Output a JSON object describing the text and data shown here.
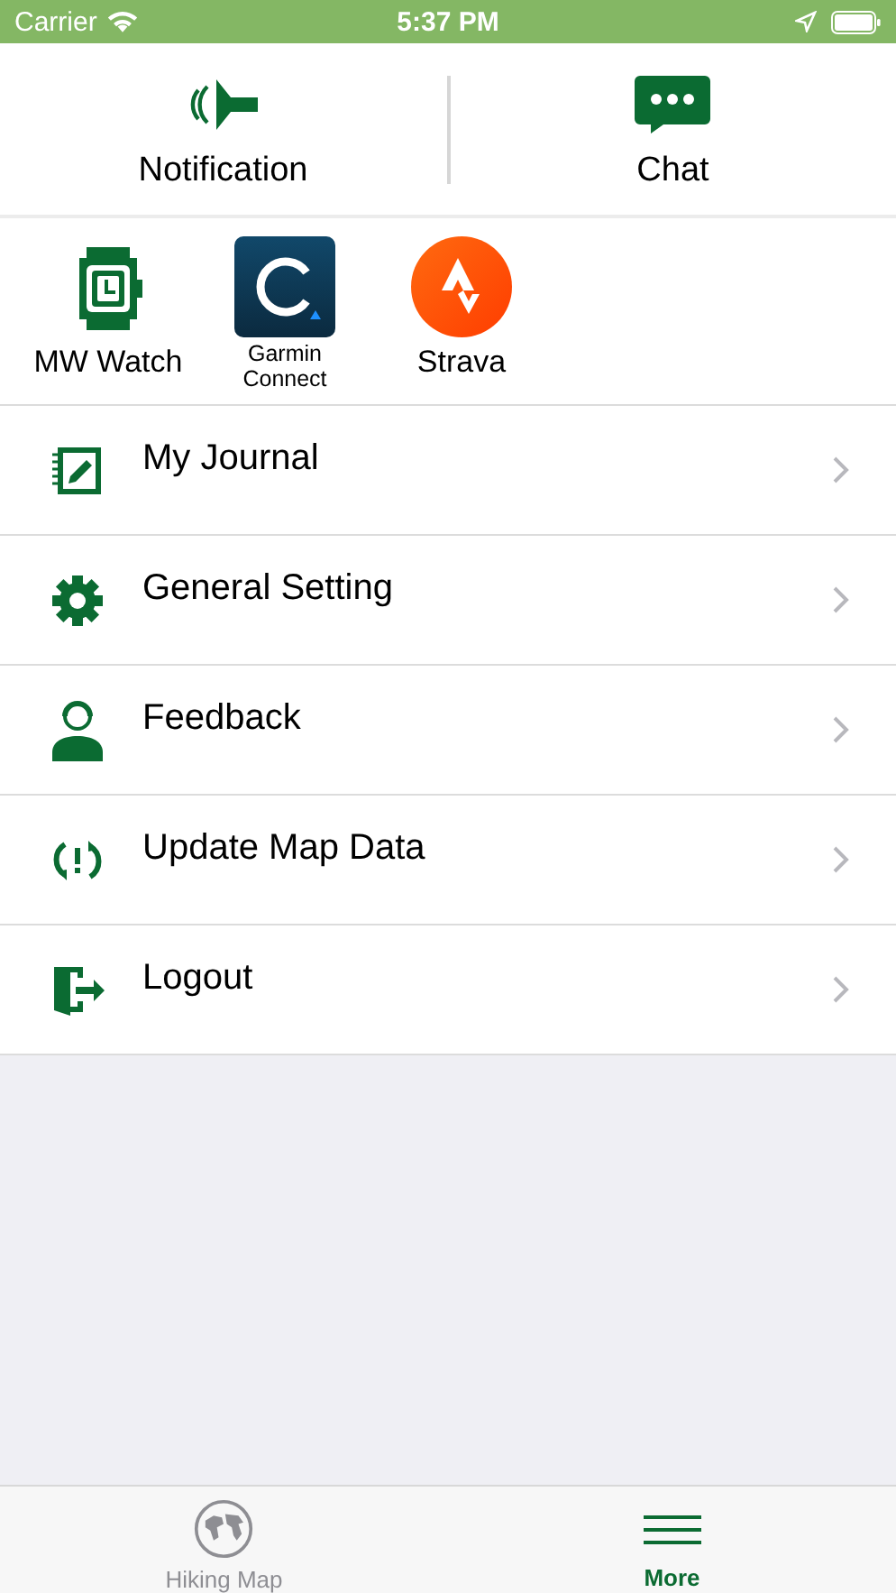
{
  "status_bar": {
    "carrier": "Carrier",
    "time": "5:37 PM"
  },
  "top_actions": [
    {
      "label": "Notification"
    },
    {
      "label": "Chat"
    }
  ],
  "apps": [
    {
      "label": "MW Watch"
    },
    {
      "label": "Garmin Connect"
    },
    {
      "label": "Strava"
    }
  ],
  "menu": [
    {
      "label": "My Journal"
    },
    {
      "label": "General Setting"
    },
    {
      "label": "Feedback"
    },
    {
      "label": "Update Map Data"
    },
    {
      "label": "Logout"
    }
  ],
  "tab_bar": [
    {
      "label": "Hiking Map",
      "selected": false
    },
    {
      "label": "More",
      "selected": true
    }
  ]
}
